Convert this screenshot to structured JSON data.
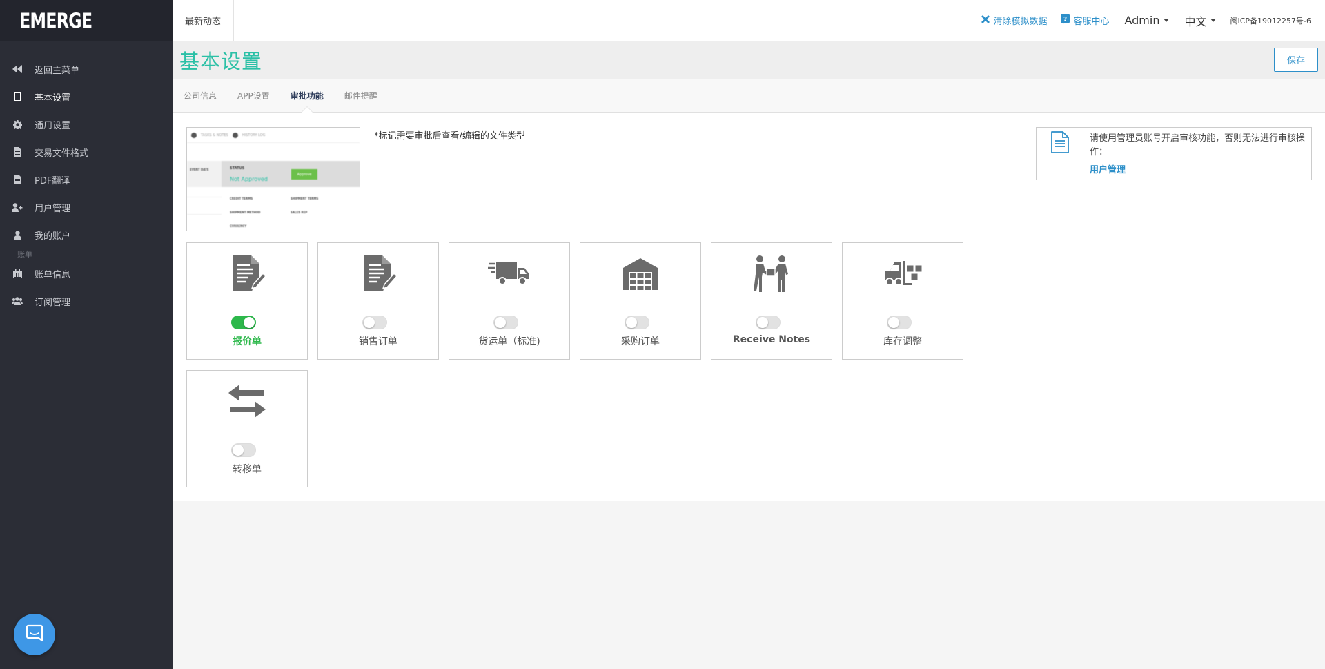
{
  "brand": {
    "logo_text": "EMERGE"
  },
  "sidebar": {
    "items": [
      {
        "label": "返回主菜单",
        "icon": "backward-icon"
      },
      {
        "label": "基本设置",
        "icon": "book-icon"
      },
      {
        "label": "通用设置",
        "icon": "gear-icon"
      },
      {
        "label": "交易文件格式",
        "icon": "file-text-icon"
      },
      {
        "label": "PDF翻译",
        "icon": "file-text-icon"
      },
      {
        "label": "用户管理",
        "icon": "user-plus-icon"
      },
      {
        "label": "我的账户",
        "icon": "user-icon"
      }
    ],
    "section_label": "账单",
    "section_items": [
      {
        "label": "账单信息",
        "icon": "calendar-icon"
      },
      {
        "label": "订阅管理",
        "icon": "users-icon"
      }
    ]
  },
  "topbar": {
    "news": "最新动态",
    "clear_demo": "清除模拟数据",
    "help": "客服中心",
    "user": "Admin",
    "language": "中文",
    "icp": "闽ICP备19012257号-6"
  },
  "page": {
    "title": "基本设置",
    "save_label": "保存"
  },
  "tabs": [
    {
      "label": "公司信息",
      "active": false
    },
    {
      "label": "APP设置",
      "active": false
    },
    {
      "label": "审批功能",
      "active": true
    },
    {
      "label": "邮件提醒",
      "active": false
    }
  ],
  "preview": {
    "tab1": "TASKS & NOTES",
    "tab2": "HISTORY LOG",
    "event_date": "EVENT DATE",
    "status": "STATUS",
    "not_approved": "Not Approved",
    "approve": "Approve",
    "credit_terms": "CREDIT TERMS",
    "shipment_terms": "SHIPMENT TERMS",
    "shipment_method": "SHIPMENT METHOD",
    "sales_rep": "SALES REP",
    "currency": "CURRENCY"
  },
  "note": "*标记需要审批后查看/编辑的文件类型",
  "info": {
    "text": "请使用管理员账号开启审核功能，否则无法进行审核操作：",
    "link": "用户管理"
  },
  "doc_types": [
    {
      "label": "报价单",
      "icon": "quote-edit-icon",
      "enabled": true
    },
    {
      "label": "销售订单",
      "icon": "sales-order-edit-icon",
      "enabled": false
    },
    {
      "label": "货运单（标准)",
      "icon": "truck-icon",
      "enabled": false
    },
    {
      "label": "采购订单",
      "icon": "warehouse-icon",
      "enabled": false
    },
    {
      "label": "Receive Notes",
      "icon": "delivery-person-icon",
      "enabled": false
    },
    {
      "label": "库存调整",
      "icon": "forklift-icon",
      "enabled": false
    },
    {
      "label": "转移单",
      "icon": "transfer-arrows-icon",
      "enabled": false
    }
  ],
  "colors": {
    "sidebar_bg": "#2b2d36",
    "accent_teal": "#2bc0a6",
    "link_blue": "#2d8fc9",
    "toggle_on": "#2db84b"
  }
}
